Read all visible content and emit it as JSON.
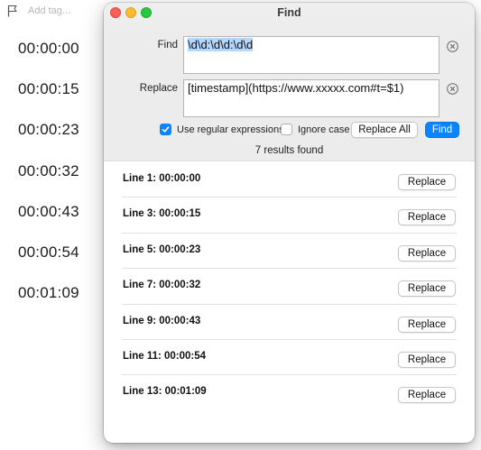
{
  "editor": {
    "tag_placeholder": "Add tag...",
    "lines": [
      "00:00:00",
      "00:00:15",
      "00:00:23",
      "00:00:32",
      "00:00:43",
      "00:00:54",
      "00:01:09"
    ]
  },
  "find_window": {
    "title": "Find",
    "find_label": "Find",
    "find_value": "\\d\\d:\\d\\d:\\d\\d",
    "replace_label": "Replace",
    "replace_value": "[timestamp](https://www.xxxxx.com#t=$1)",
    "use_regex_label": "Use regular expressions",
    "use_regex_checked": true,
    "ignore_case_label": "Ignore case",
    "ignore_case_checked": false,
    "replace_all_label": "Replace All",
    "find_button_label": "Find",
    "results_count": "7 results found",
    "results": [
      {
        "label": "Line 1: 00:00:00",
        "button": "Replace"
      },
      {
        "label": "Line 3: 00:00:15",
        "button": "Replace"
      },
      {
        "label": "Line 5: 00:00:23",
        "button": "Replace"
      },
      {
        "label": "Line 7: 00:00:32",
        "button": "Replace"
      },
      {
        "label": "Line 9: 00:00:43",
        "button": "Replace"
      },
      {
        "label": "Line 11: 00:00:54",
        "button": "Replace"
      },
      {
        "label": "Line 13: 00:01:09",
        "button": "Replace"
      }
    ]
  },
  "colors": {
    "accent": "#0a84ff",
    "close_light": "#fe5f57",
    "minimize_light": "#febc2e",
    "zoom_light": "#28c840",
    "selection": "#b4d7fe"
  },
  "icons": {
    "tag": "flag-icon",
    "clear": "clear-icon",
    "check": "checkmark-icon"
  }
}
